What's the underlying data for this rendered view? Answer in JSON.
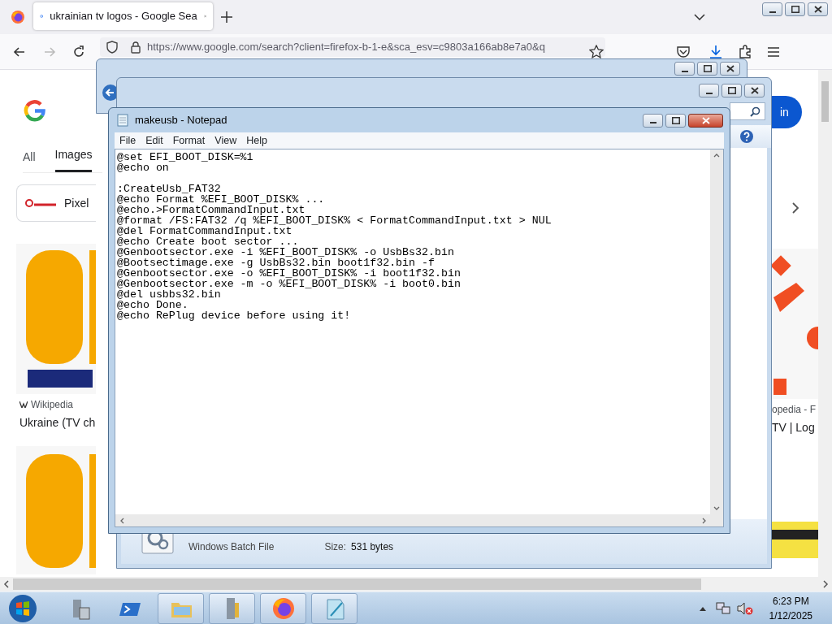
{
  "browser": {
    "tabs": [
      {
        "title": "ukrainian tv logos - Google Sea",
        "selected": true
      }
    ],
    "url": "https://www.google.com/search?client=firefox-b-1-e&sca_esv=c9803a166ab8e7a0&q",
    "page": {
      "search_tabs": [
        {
          "label": "All",
          "selected": false
        },
        {
          "label": "Images",
          "selected": true
        }
      ],
      "chips": [
        {
          "label": "Pixel"
        }
      ],
      "sign_in": "in",
      "results": [
        {
          "source": "Wikipedia",
          "title": "Ukraine (TV ch"
        },
        {
          "source": "opedia - F",
          "title": "TV | Log"
        }
      ]
    }
  },
  "explorer": {
    "details": {
      "type": "Windows Batch File",
      "size_label": "Size:",
      "size": "531 bytes"
    }
  },
  "notepad": {
    "title": "makeusb - Notepad",
    "menu": [
      "File",
      "Edit",
      "Format",
      "View",
      "Help"
    ],
    "text": "@set EFI_BOOT_DISK=%1\n@echo on\n\n:CreateUsb_FAT32\n@echo Format %EFI_BOOT_DISK% ...\n@echo.>FormatCommandInput.txt\n@format /FS:FAT32 /q %EFI_BOOT_DISK% < FormatCommandInput.txt > NUL\n@del FormatCommandInput.txt\n@echo Create boot sector ...\n@Genbootsector.exe -i %EFI_BOOT_DISK% -o UsbBs32.bin\n@Bootsectimage.exe -g UsbBs32.bin boot1f32.bin -f\n@Genbootsector.exe -o %EFI_BOOT_DISK% -i boot1f32.bin\n@Genbootsector.exe -m -o %EFI_BOOT_DISK% -i boot0.bin\n@del usbbs32.bin\n@echo Done.\n@echo RePlug device before using it!"
  },
  "taskbar": {
    "apps": [
      {
        "kind": "server",
        "open": false
      },
      {
        "kind": "powershell",
        "open": false
      },
      {
        "kind": "folder",
        "open": true
      },
      {
        "kind": "tools",
        "open": true
      },
      {
        "kind": "firefox",
        "open": true
      },
      {
        "kind": "notepad",
        "open": true
      }
    ],
    "time": "6:23 PM",
    "date": "1/12/2025"
  }
}
